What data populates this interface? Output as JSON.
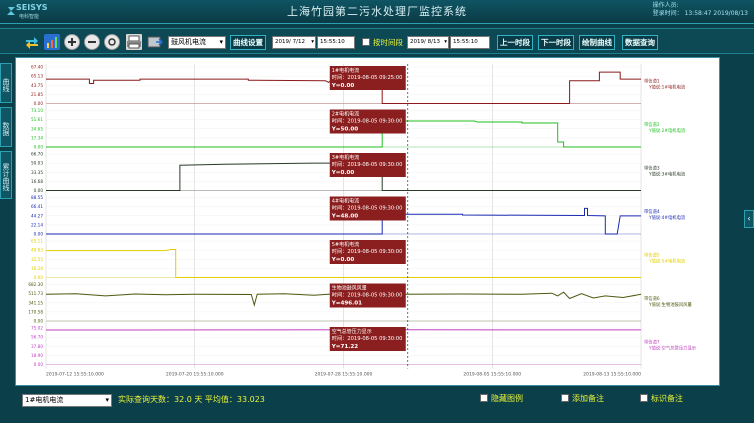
{
  "header": {
    "logo_text": "SEISYS",
    "logo_sub": "电科智能",
    "title": "上海竹园第二污水处理厂监控系统",
    "user_line": "操作人员:",
    "time_line": "登录时间：    13:58:47 2019/08/13"
  },
  "toolbar": {
    "signal_select": "鼓风机电流",
    "curve_settings": "曲线设置",
    "start_date": "2019/ 7/12",
    "start_time": "15:55:10",
    "segment_label": "按时间段",
    "end_date": "2019/ 8/13",
    "end_time": "15:55:10",
    "prev_period": "上一时段",
    "next_period": "下一时段",
    "draw_curve": "绘制曲线",
    "data_query": "数据查询"
  },
  "sidetabs": [
    "曲线",
    "数据",
    "累计曲线"
  ],
  "chart_data": {
    "type": "line",
    "x_ticks": [
      "2019-07-12 15:55:10.000",
      "2019-07-20 15:55:10.000",
      "2019-07-28 15:55:10.000",
      "2019-08-05 15:55:10.000",
      "2019-08-13 15:55:10.000"
    ],
    "cursor_time": "2019-08-05",
    "panels": [
      {
        "name": "1#电机电流",
        "legend_line1": "带信道1",
        "legend_line2": "Y值说:1#电机电流",
        "color": "#8b1a1a",
        "yticks": [
          "67.40",
          "65.13",
          "43.75",
          "21.85",
          "0.00"
        ],
        "ymax": 67.4,
        "tooltip_title": "1#电机电流",
        "tooltip_time": "时间：2019-08-05 09:25:00",
        "tooltip_value": "Y=0.00",
        "points": [
          [
            0,
            45
          ],
          [
            0.073,
            45
          ],
          [
            0.073,
            37
          ],
          [
            0.08,
            37
          ],
          [
            0.08,
            43
          ],
          [
            0.158,
            43
          ],
          [
            0.158,
            45
          ],
          [
            0.34,
            45
          ],
          [
            0.34,
            43
          ],
          [
            0.47,
            42
          ],
          [
            0.475,
            39
          ],
          [
            0.48,
            44
          ],
          [
            0.565,
            44
          ],
          [
            0.565,
            0
          ],
          [
            0.88,
            0
          ],
          [
            0.88,
            42
          ],
          [
            0.93,
            42
          ],
          [
            0.93,
            58
          ],
          [
            0.965,
            58
          ],
          [
            0.965,
            45
          ],
          [
            1,
            45
          ]
        ]
      },
      {
        "name": "2#电机电流",
        "legend_line1": "带信道2",
        "legend_line2": "Y值说:2#电机电流",
        "color": "#1fbf1f",
        "yticks": [
          "73.10",
          "51.61",
          "34.65",
          "17.34",
          "0.00"
        ],
        "ymax": 73.1,
        "tooltip_title": "2#电机电流",
        "tooltip_time": "时间：2019-08-05 09:30:00",
        "tooltip_value": "Y=50.00",
        "points": [
          [
            0,
            0
          ],
          [
            0.565,
            0
          ],
          [
            0.565,
            50
          ],
          [
            0.57,
            50
          ],
          [
            0.57,
            52
          ],
          [
            0.72,
            52
          ],
          [
            0.725,
            50
          ],
          [
            0.8,
            50
          ],
          [
            0.8,
            48
          ],
          [
            0.86,
            48
          ],
          [
            0.86,
            10
          ],
          [
            0.87,
            10
          ],
          [
            0.87,
            0
          ],
          [
            1,
            0
          ]
        ]
      },
      {
        "name": "3#电机电流",
        "legend_line1": "带信道3",
        "legend_line2": "Y值说:3#电机电流",
        "color": "#2b3b2b",
        "yticks": [
          "66.70",
          "50.03",
          "33.35",
          "16.68",
          "0.00"
        ],
        "ymax": 66.7,
        "tooltip_title": "3#电机电流",
        "tooltip_time": "时间：2019-08-05 09:30:00",
        "tooltip_value": "Y=0.00",
        "points": [
          [
            0,
            0
          ],
          [
            0.225,
            0
          ],
          [
            0.225,
            46
          ],
          [
            0.3,
            48
          ],
          [
            0.45,
            50
          ],
          [
            0.53,
            50
          ],
          [
            0.55,
            48
          ],
          [
            0.565,
            48
          ],
          [
            0.565,
            0
          ],
          [
            1,
            0
          ]
        ]
      },
      {
        "name": "4#电机电流",
        "legend_line1": "带信道4",
        "legend_line2": "Y值说:4#电机电流",
        "color": "#1a2ab0",
        "yticks": [
          "88.55",
          "66.41",
          "44.27",
          "22.14",
          "0.00"
        ],
        "ymax": 88.55,
        "tooltip_title": "4#电机电流",
        "tooltip_time": "时间：2019-08-05 09:30:00",
        "tooltip_value": "Y=48.00",
        "points": [
          [
            0,
            0
          ],
          [
            0.565,
            0
          ],
          [
            0.565,
            48
          ],
          [
            0.7,
            48
          ],
          [
            0.7,
            46
          ],
          [
            0.905,
            45
          ],
          [
            0.905,
            62
          ],
          [
            0.91,
            62
          ],
          [
            0.91,
            45
          ],
          [
            0.94,
            44
          ],
          [
            0.94,
            0
          ],
          [
            0.96,
            0
          ],
          [
            0.965,
            44
          ],
          [
            1,
            44
          ]
        ]
      },
      {
        "name": "5#电机电流",
        "legend_line1": "带信道5",
        "legend_line2": "Y值说:5#电机电流",
        "color": "#e0d000",
        "yticks": [
          "65.11",
          "48.83",
          "32.55",
          "16.28",
          "0.00"
        ],
        "ymax": 65.11,
        "tooltip_title": "5#电机电流",
        "tooltip_time": "时间：2019-08-05 09:30:00",
        "tooltip_value": "Y=0.00",
        "points": [
          [
            0,
            48
          ],
          [
            0.2,
            48
          ],
          [
            0.21,
            50
          ],
          [
            0.218,
            50
          ],
          [
            0.218,
            0
          ],
          [
            1,
            0
          ]
        ]
      },
      {
        "name": "生物池鼓风风量",
        "legend_line1": "带信道6",
        "legend_line2": "Y值说:生物池鼓风风量",
        "color": "#4a5a10",
        "yticks": [
          "682.30",
          "511.73",
          "341.15",
          "170.58",
          "0.00"
        ],
        "ymax": 682.3,
        "tooltip_title": "生物池鼓风风量",
        "tooltip_time": "时间：2019-08-05 09:30:00",
        "tooltip_value": "Y=496.01",
        "points": [
          [
            0,
            500
          ],
          [
            0.05,
            510
          ],
          [
            0.1,
            470
          ],
          [
            0.15,
            505
          ],
          [
            0.2,
            490
          ],
          [
            0.25,
            500
          ],
          [
            0.345,
            495
          ],
          [
            0.35,
            300
          ],
          [
            0.355,
            500
          ],
          [
            0.4,
            510
          ],
          [
            0.45,
            480
          ],
          [
            0.5,
            520
          ],
          [
            0.55,
            470
          ],
          [
            0.56,
            330
          ],
          [
            0.565,
            490
          ],
          [
            0.6,
            500
          ],
          [
            0.7,
            505
          ],
          [
            0.8,
            500
          ],
          [
            0.85,
            520
          ],
          [
            0.86,
            470
          ],
          [
            0.87,
            540
          ],
          [
            0.88,
            420
          ],
          [
            0.9,
            510
          ],
          [
            0.92,
            430
          ],
          [
            0.94,
            470
          ],
          [
            0.97,
            440
          ],
          [
            1,
            500
          ]
        ]
      },
      {
        "name": "空气总管压力显示",
        "legend_line1": "带信道7",
        "legend_line2": "Y值说:空气总管压力显示",
        "color": "#c040c0",
        "yticks": [
          "75.02",
          "56.70",
          "37.80",
          "18.90",
          "0.00"
        ],
        "ymax": 75.02,
        "tooltip_title": "空气总管压力显示",
        "tooltip_time": "时间：2019-08-05 09:30:00",
        "tooltip_value": "Y=71.22",
        "points": [
          [
            0,
            71
          ],
          [
            0.3,
            71.2
          ],
          [
            0.6,
            71.3
          ],
          [
            0.8,
            71.1
          ],
          [
            1,
            71.2
          ]
        ]
      }
    ]
  },
  "bottom": {
    "signal_select": "1#电机电流",
    "summary": "实际查询天数：32.0  天  平均值：33.023",
    "hide_legend": "隐藏图例",
    "add_note": "添加备注",
    "mark_note": "标识备注"
  }
}
